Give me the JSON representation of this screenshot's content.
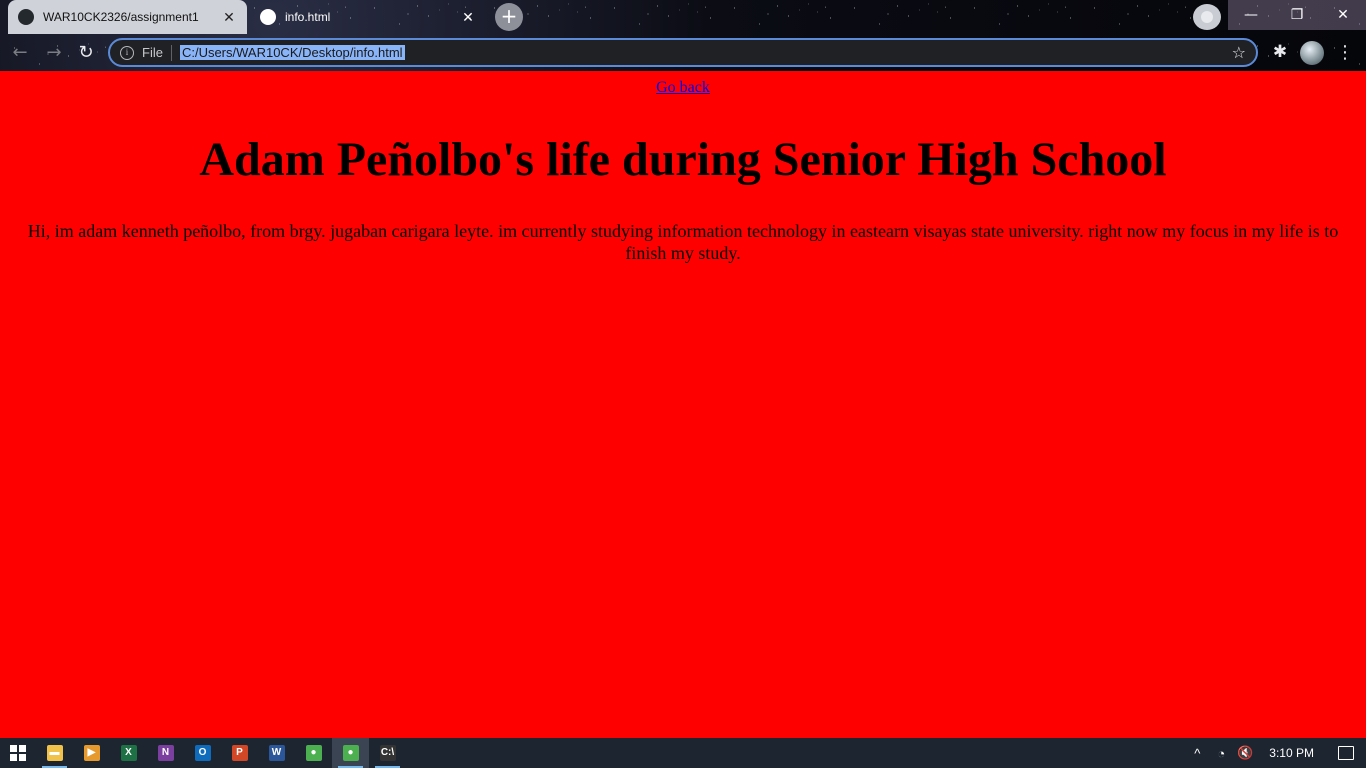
{
  "browser": {
    "tabs": [
      {
        "label": "WAR10CK2326/assignment1",
        "icon": "github-icon",
        "active": true
      },
      {
        "label": "info.html",
        "icon": "globe-icon",
        "active": false
      }
    ],
    "new_tab": "+",
    "close_glyph": "✕",
    "address": {
      "security_label": "File",
      "url": "C:/Users/WAR10CK/Desktop/info.html"
    },
    "window_controls": {
      "minimize": "—",
      "maximize": "❐",
      "close": "✕"
    },
    "nav": {
      "back": "←",
      "forward": "→",
      "reload": "↻"
    },
    "star": "☆",
    "extensions": "✱",
    "menu": "⋮"
  },
  "page": {
    "link": "Go back",
    "heading": "Adam Peñolbo's life during Senior High School",
    "paragraph": "Hi, im adam kenneth peñolbo, from brgy. jugaban carigara leyte. im currently studying information technology in eastearn visayas state university. right now my focus in my life is to finish my study.",
    "background": "#ff0000",
    "link_color": "#0000ee"
  },
  "taskbar": {
    "apps": [
      {
        "name": "file-explorer-icon",
        "glyph": "▬",
        "color": "#f0c24a",
        "running": true
      },
      {
        "name": "media-player-icon",
        "glyph": "▶",
        "color": "#e69a2e",
        "running": false
      },
      {
        "name": "excel-icon",
        "glyph": "X",
        "color": "#1e7145",
        "running": false
      },
      {
        "name": "onenote-icon",
        "glyph": "N",
        "color": "#7b3fa0",
        "running": false
      },
      {
        "name": "outlook-icon",
        "glyph": "O",
        "color": "#0f6cbd",
        "running": false
      },
      {
        "name": "powerpoint-icon",
        "glyph": "P",
        "color": "#d24726",
        "running": false
      },
      {
        "name": "word-icon",
        "glyph": "W",
        "color": "#2b579a",
        "running": false
      },
      {
        "name": "chrome-icon",
        "glyph": "●",
        "color": "#4caf50",
        "running": false
      },
      {
        "name": "chrome-active-icon",
        "glyph": "●",
        "color": "#4caf50",
        "running": true,
        "focused": true
      },
      {
        "name": "terminal-icon",
        "glyph": "C:\\",
        "color": "#333",
        "running": true
      }
    ],
    "tray": {
      "chevron": "^",
      "wifi": "◔",
      "volume": "🔇",
      "time": "3:10 PM"
    }
  }
}
